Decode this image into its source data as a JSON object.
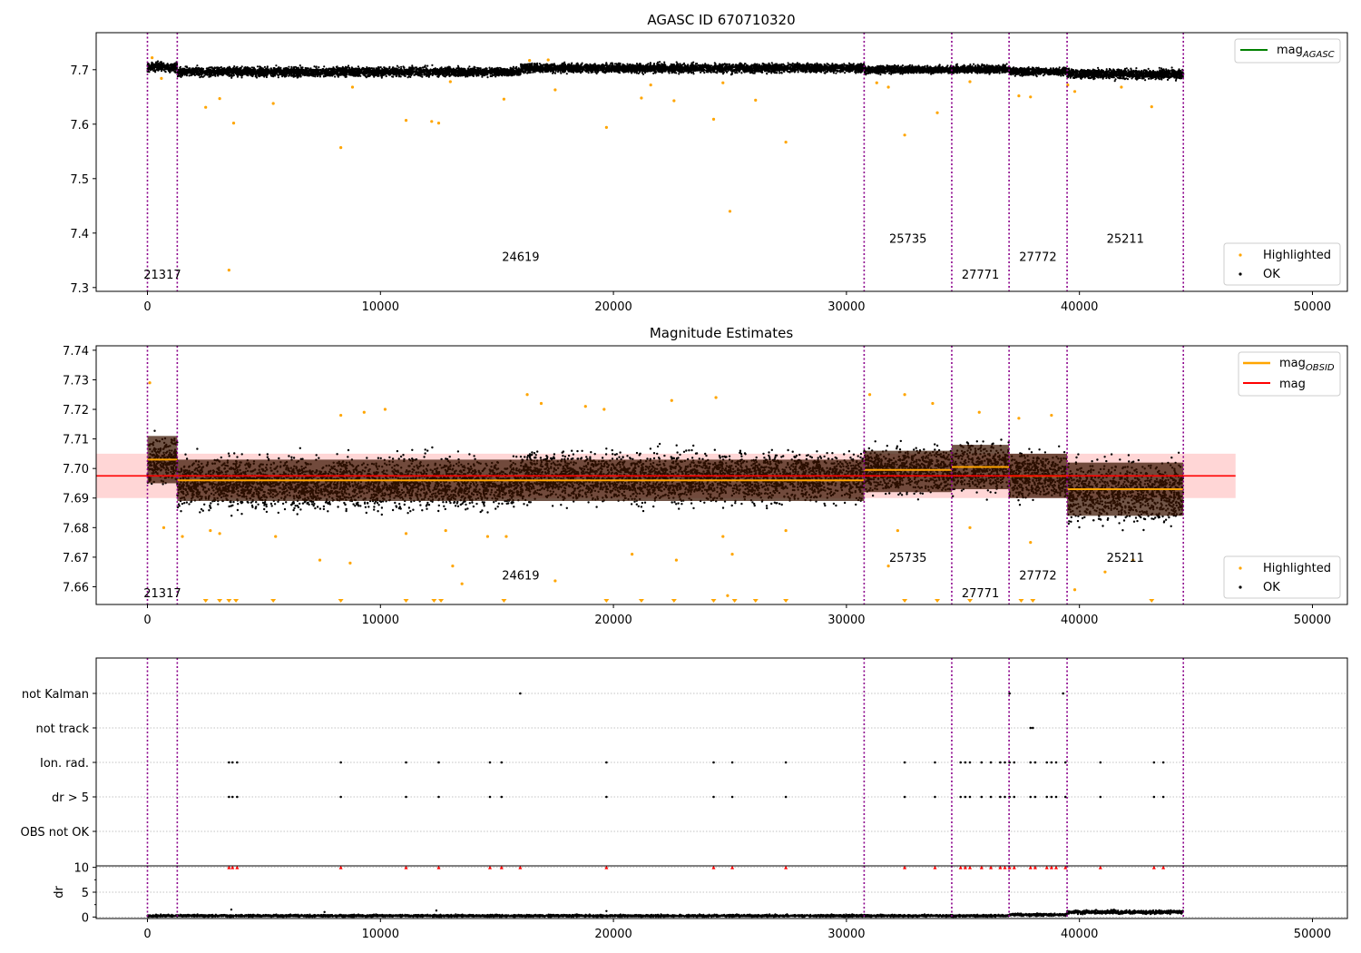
{
  "colors": {
    "ok": "#000000",
    "highlighted": "#ffa500",
    "mag_agasc": "#008000",
    "mag_obsid": "#ffa500",
    "mag": "#ff0000",
    "mag_band": "#ffd6d6",
    "obs_band": "#3a1400",
    "obs_line": "#8b008b",
    "obs_line_dot": "#0000cc",
    "flag_red": "#ff0000",
    "grid": "#b0b0b0"
  },
  "chart_data": [
    {
      "type": "scatter",
      "title": "AGASC ID 670710320",
      "xlim": [
        -2200,
        51500
      ],
      "ylim": [
        7.293,
        7.768
      ],
      "xticks": [
        0,
        10000,
        20000,
        30000,
        40000,
        50000
      ],
      "xtick_labels": [
        "0",
        "10000",
        "20000",
        "30000",
        "40000",
        "50000"
      ],
      "yticks": [
        7.3,
        7.4,
        7.5,
        7.6,
        7.7
      ],
      "ytick_labels": [
        "7.3",
        "7.4",
        "7.5",
        "7.6",
        "7.7"
      ],
      "obs_boundaries": [
        0,
        1280,
        30760,
        34520,
        36980,
        39470,
        44460
      ],
      "obsids": [
        {
          "label": "21317",
          "x": 640,
          "y": 7.316
        },
        {
          "label": "24619",
          "x": 16020,
          "y": 7.349
        },
        {
          "label": "25735",
          "x": 32640,
          "y": 7.382
        },
        {
          "label": "27771",
          "x": 35750,
          "y": 7.316
        },
        {
          "label": "27772",
          "x": 38220,
          "y": 7.349
        },
        {
          "label": "25211",
          "x": 41970,
          "y": 7.382
        }
      ],
      "series": [
        {
          "name": "OK",
          "segments": [
            {
              "x": [
                0,
                1280
              ],
              "level": 7.705,
              "spread": 0.012
            },
            {
              "x": [
                1280,
                16020
              ],
              "level": 7.696,
              "spread": 0.012
            },
            {
              "x": [
                16020,
                30760
              ],
              "level": 7.703,
              "spread": 0.012
            },
            {
              "x": [
                30760,
                34520
              ],
              "level": 7.7,
              "spread": 0.01
            },
            {
              "x": [
                34520,
                36980
              ],
              "level": 7.701,
              "spread": 0.01
            },
            {
              "x": [
                36980,
                39470
              ],
              "level": 7.697,
              "spread": 0.01
            },
            {
              "x": [
                39470,
                44460
              ],
              "level": 7.692,
              "spread": 0.012
            }
          ]
        },
        {
          "name": "Highlighted",
          "points": [
            [
              200,
              7.722
            ],
            [
              600,
              7.684
            ],
            [
              2500,
              7.631
            ],
            [
              3100,
              7.647
            ],
            [
              3500,
              7.332
            ],
            [
              3700,
              7.602
            ],
            [
              5400,
              7.638
            ],
            [
              8300,
              7.557
            ],
            [
              8800,
              7.668
            ],
            [
              11100,
              7.607
            ],
            [
              12200,
              7.605
            ],
            [
              12500,
              7.602
            ],
            [
              13000,
              7.678
            ],
            [
              15300,
              7.646
            ],
            [
              16400,
              7.717
            ],
            [
              17200,
              7.718
            ],
            [
              17500,
              7.663
            ],
            [
              19700,
              7.594
            ],
            [
              21200,
              7.648
            ],
            [
              21600,
              7.672
            ],
            [
              22600,
              7.643
            ],
            [
              24300,
              7.609
            ],
            [
              24700,
              7.676
            ],
            [
              25000,
              7.44
            ],
            [
              26100,
              7.644
            ],
            [
              27400,
              7.567
            ],
            [
              31300,
              7.676
            ],
            [
              31800,
              7.668
            ],
            [
              32500,
              7.58
            ],
            [
              33900,
              7.621
            ],
            [
              35300,
              7.678
            ],
            [
              37400,
              7.652
            ],
            [
              37900,
              7.65
            ],
            [
              39500,
              7.672
            ],
            [
              39800,
              7.66
            ],
            [
              41800,
              7.668
            ],
            [
              43100,
              7.632
            ]
          ]
        },
        {
          "name": "mag_AGASC",
          "value": 7.698
        }
      ],
      "legend": {
        "upper": [
          "mag_AGASC"
        ],
        "lower": [
          "Highlighted",
          "OK"
        ],
        "placement": "top-right / bottom-right"
      }
    },
    {
      "type": "scatter",
      "title": "Magnitude Estimates",
      "xlim": [
        -2200,
        51500
      ],
      "ylim": [
        7.654,
        7.7415
      ],
      "xticks": [
        0,
        10000,
        20000,
        30000,
        40000,
        50000
      ],
      "xtick_labels": [
        "0",
        "10000",
        "20000",
        "30000",
        "40000",
        "50000"
      ],
      "yticks": [
        7.66,
        7.67,
        7.68,
        7.69,
        7.7,
        7.71,
        7.72,
        7.73,
        7.74
      ],
      "ytick_labels": [
        "7.66",
        "7.67",
        "7.68",
        "7.69",
        "7.70",
        "7.71",
        "7.72",
        "7.73",
        "7.74"
      ],
      "obs_boundaries": [
        0,
        1280,
        30760,
        34520,
        36980,
        39470,
        44460
      ],
      "mag": {
        "value": 7.6975,
        "band": [
          7.69,
          7.705
        ],
        "xrange": [
          -2200,
          46700
        ]
      },
      "mag_obsid": [
        {
          "x": [
            0,
            1280
          ],
          "value": 7.703,
          "band": [
            7.695,
            7.711
          ]
        },
        {
          "x": [
            1280,
            30760
          ],
          "value": 7.696,
          "band": [
            7.689,
            7.703
          ]
        },
        {
          "x": [
            30760,
            34520
          ],
          "value": 7.6995,
          "band": [
            7.692,
            7.706
          ]
        },
        {
          "x": [
            34520,
            36980
          ],
          "value": 7.7005,
          "band": [
            7.693,
            7.708
          ]
        },
        {
          "x": [
            36980,
            39470
          ],
          "value": 7.6975,
          "band": [
            7.69,
            7.705
          ]
        },
        {
          "x": [
            39470,
            44460
          ],
          "value": 7.693,
          "band": [
            7.684,
            7.702
          ]
        }
      ],
      "obsids": [
        {
          "label": "21317",
          "x": 640,
          "y": 7.6565
        },
        {
          "label": "24619",
          "x": 16020,
          "y": 7.6625
        },
        {
          "label": "25735",
          "x": 32640,
          "y": 7.6685
        },
        {
          "label": "27771",
          "x": 35750,
          "y": 7.6565
        },
        {
          "label": "27772",
          "x": 38220,
          "y": 7.6625
        },
        {
          "label": "25211",
          "x": 41970,
          "y": 7.6685
        }
      ],
      "series": [
        {
          "name": "OK",
          "segments": [
            {
              "x": [
                0,
                1280
              ],
              "level": 7.703,
              "spread": 0.011
            },
            {
              "x": [
                1280,
                16020
              ],
              "level": 7.695,
              "spread": 0.012
            },
            {
              "x": [
                16020,
                30760
              ],
              "level": 7.697,
              "spread": 0.012
            },
            {
              "x": [
                30760,
                34520
              ],
              "level": 7.6995,
              "spread": 0.011
            },
            {
              "x": [
                34520,
                36980
              ],
              "level": 7.7005,
              "spread": 0.011
            },
            {
              "x": [
                36980,
                39470
              ],
              "level": 7.6975,
              "spread": 0.011
            },
            {
              "x": [
                39470,
                44460
              ],
              "level": 7.692,
              "spread": 0.014
            }
          ]
        },
        {
          "name": "Highlighted",
          "points": [
            [
              100,
              7.729
            ],
            [
              700,
              7.68
            ],
            [
              1500,
              7.677
            ],
            [
              2700,
              7.679
            ],
            [
              3100,
              7.678
            ],
            [
              5500,
              7.677
            ],
            [
              7400,
              7.669
            ],
            [
              8300,
              7.718
            ],
            [
              8700,
              7.668
            ],
            [
              9300,
              7.719
            ],
            [
              10200,
              7.72
            ],
            [
              11100,
              7.678
            ],
            [
              12800,
              7.679
            ],
            [
              13100,
              7.667
            ],
            [
              13500,
              7.661
            ],
            [
              14600,
              7.677
            ],
            [
              15400,
              7.677
            ],
            [
              16300,
              7.725
            ],
            [
              16900,
              7.722
            ],
            [
              17500,
              7.662
            ],
            [
              18800,
              7.721
            ],
            [
              19600,
              7.72
            ],
            [
              20800,
              7.671
            ],
            [
              22500,
              7.723
            ],
            [
              22700,
              7.669
            ],
            [
              24400,
              7.724
            ],
            [
              24700,
              7.677
            ],
            [
              24900,
              7.657
            ],
            [
              25100,
              7.671
            ],
            [
              27400,
              7.679
            ],
            [
              31000,
              7.725
            ],
            [
              31800,
              7.667
            ],
            [
              32200,
              7.679
            ],
            [
              32500,
              7.725
            ],
            [
              33700,
              7.722
            ],
            [
              35300,
              7.68
            ],
            [
              35700,
              7.719
            ],
            [
              37400,
              7.717
            ],
            [
              37900,
              7.675
            ],
            [
              38800,
              7.718
            ],
            [
              39800,
              7.659
            ],
            [
              41100,
              7.665
            ],
            [
              42300,
              7.669
            ]
          ]
        },
        {
          "name": "Highlighted (below range)",
          "points": [
            2500,
            3100,
            3500,
            3800,
            5400,
            8300,
            11100,
            12300,
            12600,
            15300,
            19700,
            21200,
            22600,
            24300,
            25200,
            26100,
            27400,
            32500,
            33900,
            35300,
            37500,
            38000,
            43100
          ]
        }
      ],
      "legend": {
        "upper": [
          "mag_OBSID",
          "mag"
        ],
        "lower": [
          "Highlighted",
          "OK"
        ],
        "placement": "top-right / bottom-right"
      }
    },
    {
      "type": "scatter",
      "title": "",
      "xlim": [
        -2200,
        51500
      ],
      "categories": [
        "not Kalman",
        "not track",
        "Ion. rad.",
        "dr > 5",
        "OBS not OK"
      ],
      "obs_boundaries": [
        0,
        1280,
        30760,
        34520,
        36980,
        39470,
        44460
      ],
      "flags": {
        "not Kalman": [
          16000,
          37000,
          39300
        ],
        "not track": [
          37900,
          38000
        ],
        "Ion. rad.": [
          3500,
          3650,
          3850,
          8300,
          11100,
          12500,
          14700,
          15200,
          19700,
          24300,
          25100,
          27400,
          32500,
          33800,
          34900,
          35100,
          35300,
          35800,
          36200,
          36600,
          36800,
          37000,
          37200,
          37900,
          38100,
          38600,
          38800,
          39000,
          39400,
          40900,
          43200,
          43600
        ],
        "dr > 5": [
          3500,
          3650,
          3850,
          8300,
          11100,
          12500,
          14700,
          15200,
          19700,
          24300,
          25100,
          27400,
          32500,
          33800,
          34900,
          35100,
          35300,
          35800,
          36200,
          36600,
          36800,
          37000,
          37200,
          37900,
          38100,
          38600,
          38800,
          39000,
          39400,
          40900,
          43200,
          43600
        ],
        "OBS not OK": []
      }
    },
    {
      "type": "scatter",
      "title": "",
      "ylabel": "dr",
      "xlim": [
        -2200,
        51500
      ],
      "ylim": [
        -0.3,
        10.3
      ],
      "xticks": [
        0,
        10000,
        20000,
        30000,
        40000,
        50000
      ],
      "xtick_labels": [
        "0",
        "10000",
        "20000",
        "30000",
        "40000",
        "50000"
      ],
      "yticks": [
        0,
        5,
        10
      ],
      "ytick_labels": [
        "0",
        "5",
        "10"
      ],
      "obs_boundaries": [
        0,
        1280,
        30760,
        34520,
        36980,
        39470,
        44460
      ],
      "clipped_at": 10,
      "clipped_x": [
        3500,
        3650,
        3850,
        8300,
        11100,
        12500,
        14700,
        15200,
        16000,
        19700,
        24300,
        25100,
        27400,
        32500,
        33800,
        34900,
        35100,
        35300,
        35800,
        36200,
        36600,
        36800,
        37000,
        37200,
        37900,
        38100,
        38600,
        38800,
        39000,
        39400,
        40900,
        43200,
        43600
      ],
      "series": [
        {
          "name": "dr",
          "segments": [
            {
              "x": [
                0,
                36980
              ],
              "level": 0.25,
              "spread": 0.3
            },
            {
              "x": [
                36980,
                39470
              ],
              "level": 0.45,
              "spread": 0.35
            },
            {
              "x": [
                39470,
                44460
              ],
              "level": 1.0,
              "spread": 0.5
            }
          ],
          "outliers": [
            [
              3600,
              1.5
            ],
            [
              12400,
              1.3
            ],
            [
              7600,
              1.0
            ],
            [
              19700,
              1.2
            ]
          ]
        }
      ]
    }
  ]
}
